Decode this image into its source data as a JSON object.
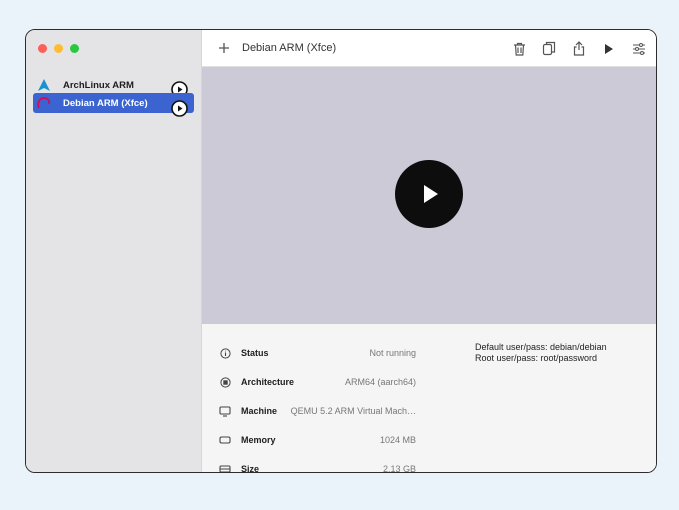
{
  "window": {
    "traffic_lights": {
      "close": "#fe5f57",
      "minimize": "#febc2e",
      "zoom": "#28c840"
    }
  },
  "sidebar": {
    "items": [
      {
        "label": "ArchLinux ARM",
        "icon": "archlinux-icon",
        "selected": false
      },
      {
        "label": "Debian ARM (Xfce)",
        "icon": "debian-icon",
        "selected": true
      }
    ],
    "selection_color": "#3b64d0"
  },
  "header": {
    "title": "Debian ARM (Xfce)",
    "toolbar": [
      "trash-icon",
      "clone-icon",
      "share-icon",
      "play-icon",
      "settings-sliders-icon"
    ]
  },
  "preview": {
    "background": "#cdcad7"
  },
  "details": {
    "rows": [
      {
        "label": "Status",
        "value": "Not running",
        "icon": "info-icon"
      },
      {
        "label": "Architecture",
        "value": "ARM64 (aarch64)",
        "icon": "cpu-icon"
      },
      {
        "label": "Machine",
        "value": "QEMU 5.2 ARM Virtual Mach…",
        "icon": "monitor-icon"
      },
      {
        "label": "Memory",
        "value": "1024 MB",
        "icon": "memory-icon"
      },
      {
        "label": "Size",
        "value": "2.13 GB",
        "icon": "drive-icon"
      }
    ],
    "notes": [
      "Default user/pass: debian/debian",
      "Root user/pass: root/password"
    ]
  }
}
